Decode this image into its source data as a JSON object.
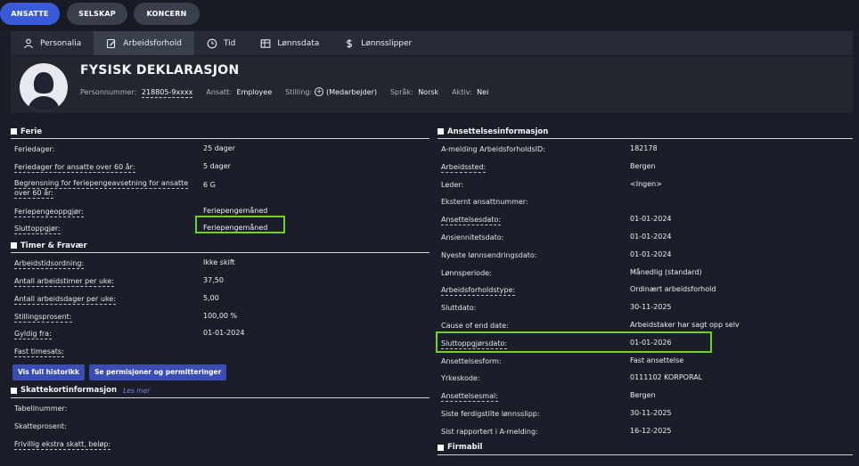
{
  "top_tabs": [
    {
      "label": "ANSATTE",
      "active": true
    },
    {
      "label": "SELSKAP",
      "active": false
    },
    {
      "label": "KONCERN",
      "active": false
    }
  ],
  "sub_tabs": [
    {
      "label": "Personalia",
      "icon": "person-icon"
    },
    {
      "label": "Arbeidsforhold",
      "icon": "edit-document-icon",
      "active": true
    },
    {
      "label": "Tid",
      "icon": "clock-icon"
    },
    {
      "label": "Lønnsdata",
      "icon": "table-icon"
    },
    {
      "label": "Lønnsslipper",
      "icon": "dollar-icon"
    }
  ],
  "employee": {
    "name": "FYSISK DEKLARASJON",
    "personnummer_label": "Personnummer:",
    "personnummer": "218805-9xxxx",
    "ansatt_label": "Ansatt:",
    "ansatt": "Employee",
    "stilling_label": "Stilling:",
    "stilling": "(Medarbejder)",
    "sprak_label": "Språk:",
    "sprak": "Norsk",
    "aktiv_label": "Aktiv:",
    "aktiv": "Nei"
  },
  "ferie": {
    "title": "Ferie",
    "rows": [
      {
        "label": "Feriedager:",
        "value": "25 dager"
      },
      {
        "label": "Feriedager for ansatte over 60 år:",
        "value": "5 dager"
      },
      {
        "label": "Begrensning for feriepengeavsetning for ansatte over 60 år:",
        "value": "6 G"
      },
      {
        "label": "Feriepengeoppgjør:",
        "value": "Feriepengemåned"
      },
      {
        "label": "Sluttoppgjør:",
        "value": "Feriepengemåned"
      }
    ]
  },
  "timer": {
    "title": "Timer & Fravær",
    "rows": [
      {
        "label": "Arbeidstidsordning:",
        "value": "Ikke skift"
      },
      {
        "label": "Antall arbeidstimer per uke:",
        "value": "37,50"
      },
      {
        "label": "Antall arbeidsdager per uke:",
        "value": "5,00"
      },
      {
        "label": "Stillingsprosent:",
        "value": "100,00 %"
      },
      {
        "label": "Gyldig fra:",
        "value": "01-01-2024"
      },
      {
        "label": "Fast timesats:",
        "value": ""
      }
    ],
    "btn_history": "Vis full historikk",
    "btn_permissions": "Se permisjoner og permitteringer"
  },
  "skattekort": {
    "title": "Skattekortinformasjon",
    "les_mer": "Les mer",
    "rows": [
      {
        "label": "Tabellnummer:",
        "value": ""
      },
      {
        "label": "Skatteprosent:",
        "value": ""
      },
      {
        "label": "Frivillig ekstra skatt, beløp:",
        "value": ""
      }
    ]
  },
  "ansettelse": {
    "title": "Ansettelsesinformasjon",
    "rows": [
      {
        "label": "A-melding ArbeidsforholdsID:",
        "value": "182178"
      },
      {
        "label": "Arbeidssted:",
        "value": "Bergen"
      },
      {
        "label": "Leder:",
        "value": "<Ingen>"
      },
      {
        "label": "Eksternt ansattnummer:",
        "value": ""
      },
      {
        "label": "Ansettelsesdato:",
        "value": "01-01-2024"
      },
      {
        "label": "Ansiennitetsdato:",
        "value": "01-01-2024"
      },
      {
        "label": "Nyeste lønnsendringsdato:",
        "value": "01-01-2024"
      },
      {
        "label": "Lønnsperiode:",
        "value": "Månedlig (standard)"
      },
      {
        "label": "Arbeidsforholdstype:",
        "value": "Ordinært arbeidsforhold"
      },
      {
        "label": "Sluttdato:",
        "value": "30-11-2025"
      },
      {
        "label": "Cause of end date:",
        "value": "Arbeidstaker har sagt opp selv"
      },
      {
        "label": "Sluttoppgjørsdato:",
        "value": "01-01-2026"
      },
      {
        "label": "Ansettelsesform:",
        "value": "Fast ansettelse"
      },
      {
        "label": "Yrkeskode:",
        "value": "0111102 KORPORAL"
      },
      {
        "label": "Ansettelsesmal:",
        "value": "Bergen"
      },
      {
        "label": "Siste ferdigstilte lønnsslipp:",
        "value": "30-11-2025"
      },
      {
        "label": "Sist rapportert i A-melding:",
        "value": "16-12-2025"
      }
    ]
  },
  "firmabil": {
    "title": "Firmabil"
  },
  "colors": {
    "accent": "#3a5bd9",
    "highlight": "#6fd12a",
    "background": "#1b1e28"
  }
}
